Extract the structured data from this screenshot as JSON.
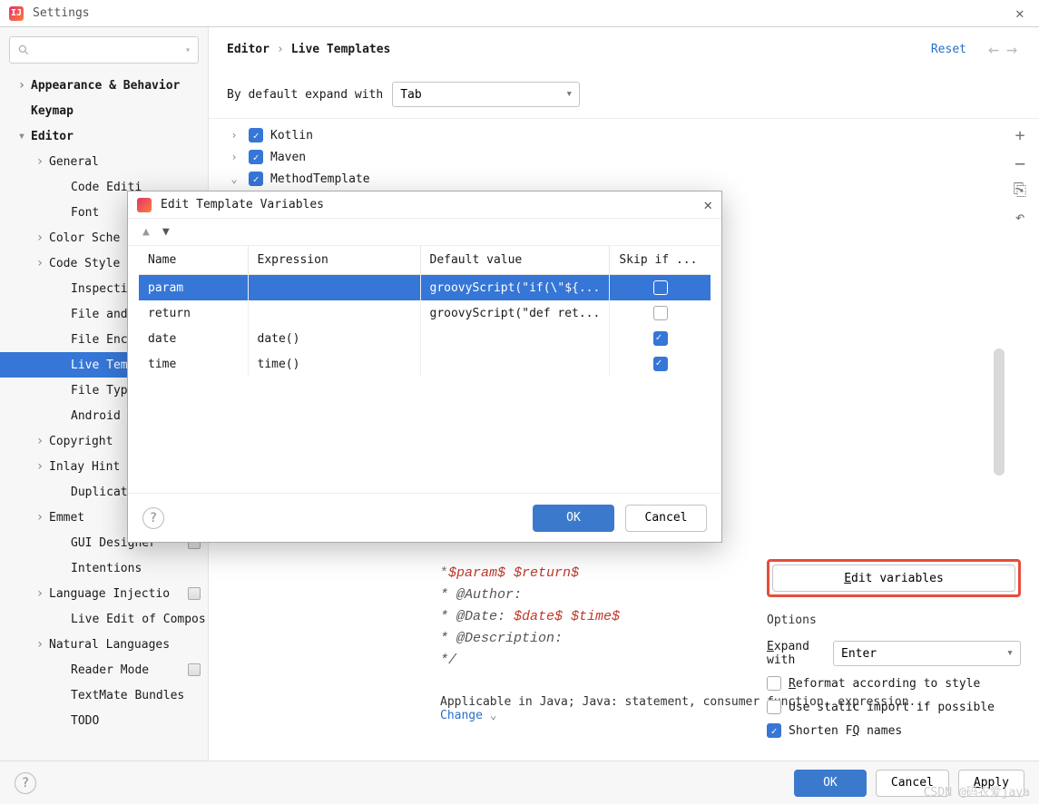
{
  "window": {
    "title": "Settings"
  },
  "sidebar": {
    "items": [
      {
        "label": "Appearance & Behavior",
        "bold": true,
        "arrow": "right",
        "lvl": 1
      },
      {
        "label": "Keymap",
        "bold": true,
        "lvl": 1,
        "noarrow": true
      },
      {
        "label": "Editor",
        "bold": true,
        "arrow": "down",
        "lvl": 1
      },
      {
        "label": "General",
        "arrow": "right",
        "lvl": 2
      },
      {
        "label": "Code Editi",
        "lvl": 3
      },
      {
        "label": "Font",
        "lvl": 3
      },
      {
        "label": "Color Sche",
        "arrow": "right",
        "lvl": 2
      },
      {
        "label": "Code Style",
        "arrow": "right",
        "lvl": 2,
        "gear": true
      },
      {
        "label": "Inspection",
        "lvl": 3,
        "gear": true
      },
      {
        "label": "File and C",
        "lvl": 3,
        "gear": true
      },
      {
        "label": "File Encod",
        "lvl": 3,
        "gear": true
      },
      {
        "label": "Live Templ",
        "lvl": 3,
        "selected": true,
        "gear": true
      },
      {
        "label": "File Types",
        "lvl": 3
      },
      {
        "label": "Android De",
        "lvl": 3
      },
      {
        "label": "Copyright",
        "arrow": "right",
        "lvl": 2,
        "gear": true
      },
      {
        "label": "Inlay Hint",
        "arrow": "right",
        "lvl": 2,
        "gear": true
      },
      {
        "label": "Duplicates",
        "lvl": 3
      },
      {
        "label": "Emmet",
        "arrow": "right",
        "lvl": 2
      },
      {
        "label": "GUI Designer",
        "lvl": 3,
        "gear": true
      },
      {
        "label": "Intentions",
        "lvl": 3
      },
      {
        "label": "Language Injectio",
        "arrow": "right",
        "lvl": 2,
        "gear": true
      },
      {
        "label": "Live Edit of Compos",
        "lvl": 3
      },
      {
        "label": "Natural Languages",
        "arrow": "right",
        "lvl": 2
      },
      {
        "label": "Reader Mode",
        "lvl": 3,
        "gear": true
      },
      {
        "label": "TextMate Bundles",
        "lvl": 3
      },
      {
        "label": "TODO",
        "lvl": 3
      }
    ]
  },
  "breadcrumb": {
    "a": "Editor",
    "b": "Live Templates",
    "reset": "Reset"
  },
  "expand": {
    "label": "By default expand with",
    "value": "Tab"
  },
  "templates": [
    {
      "label": "Kotlin",
      "arrow": "›"
    },
    {
      "label": "Maven",
      "arrow": "›"
    },
    {
      "label": "MethodTemplate",
      "arrow": "⌄"
    }
  ],
  "code": {
    "l1a": "*",
    "l1b": "$param$ $return$",
    "l2": " * @Author:",
    "l3a": " * @Date: ",
    "l3b": "$date$ $time$",
    "l4": " * @Description:",
    "l5": " */"
  },
  "applicable": {
    "text": "Applicable in Java; Java: statement, consumer function, expression...",
    "change": "Change"
  },
  "right": {
    "edit_btn": "Edit variables",
    "options_label": "Options",
    "expand_label": "Expand with",
    "expand_value": "Enter",
    "opt1": "Reformat according to style",
    "opt2": "Use static import if possible",
    "opt3": "Shorten FQ names"
  },
  "footer": {
    "ok": "OK",
    "cancel": "Cancel",
    "apply": "Apply"
  },
  "dialog": {
    "title": "Edit Template Variables",
    "cols": {
      "name": "Name",
      "expr": "Expression",
      "def": "Default value",
      "skip": "Skip if ..."
    },
    "rows": [
      {
        "name": "param",
        "expr": "",
        "def": "groovyScript(\"if(\\\"${...",
        "skip": false,
        "sel": true
      },
      {
        "name": "return",
        "expr": "",
        "def": "groovyScript(\"def ret...",
        "skip": false
      },
      {
        "name": "date",
        "expr": "date()",
        "def": "",
        "skip": true
      },
      {
        "name": "time",
        "expr": "time()",
        "def": "",
        "skip": true
      }
    ],
    "ok": "OK",
    "cancel": "Cancel"
  },
  "watermark": "CSDN @码农爱java"
}
